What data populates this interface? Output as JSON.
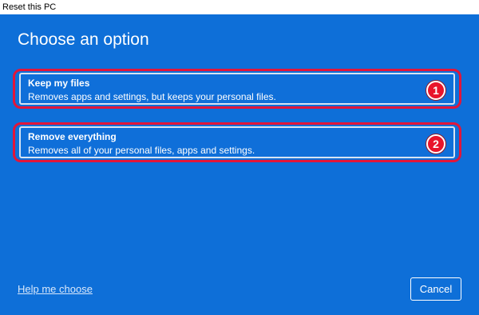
{
  "window": {
    "title": "Reset this PC"
  },
  "dialog": {
    "heading": "Choose an option",
    "options": [
      {
        "title": "Keep my files",
        "description": "Removes apps and settings, but keeps your personal files.",
        "badge": "1"
      },
      {
        "title": "Remove everything",
        "description": "Removes all of your personal files, apps and settings.",
        "badge": "2"
      }
    ],
    "help_link": "Help me choose",
    "cancel_label": "Cancel"
  },
  "colors": {
    "background": "#0e6fd8",
    "highlight_ring": "#e2163a",
    "badge": "#e8142b"
  }
}
